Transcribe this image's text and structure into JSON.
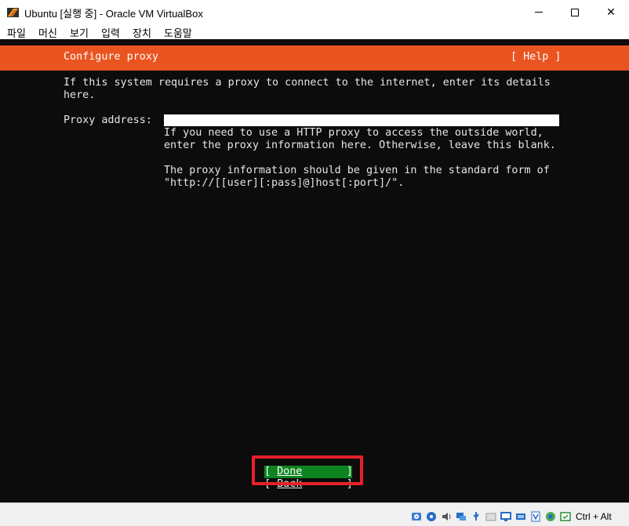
{
  "window": {
    "title": "Ubuntu [실행 중] - Oracle VM VirtualBox",
    "minimize_glyph": "",
    "maximize_glyph": "",
    "close_glyph": "✕"
  },
  "menu": {
    "items": [
      {
        "label": "파일"
      },
      {
        "label": "머신"
      },
      {
        "label": "보기"
      },
      {
        "label": "입력"
      },
      {
        "label": "장치"
      },
      {
        "label": "도움말"
      }
    ]
  },
  "installer": {
    "title": "Configure proxy",
    "help_label": "[ Help ]",
    "intro": "If this system requires a proxy to connect to the internet, enter its details\nhere.",
    "proxy_label": "Proxy address:",
    "proxy_value": "",
    "help_text_1": "If you need to use a HTTP proxy to access the outside world,\nenter the proxy information here. Otherwise, leave this blank.",
    "help_text_2": "The proxy information should be given in the standard form of\n\"http://[[user][:pass]@]host[:port]/\".",
    "done_open": "[ ",
    "done_label": "Done",
    "done_close": "       ]",
    "back_open": "[ ",
    "back_label": "Back",
    "back_close": "       ]"
  },
  "colors": {
    "ubuntu_orange": "#e95420",
    "done_green": "#0e8420",
    "annotation_red": "#e8202a",
    "console_bg": "#0c0c0c"
  },
  "statusbar": {
    "icons": [
      "hard-disk-icon",
      "optical-drive-icon",
      "audio-icon",
      "network-icon",
      "usb-icon",
      "shared-folder-icon",
      "display-icon",
      "video-capture-icon",
      "cpu-icon",
      "mouse-integration-icon",
      "keyboard-icon"
    ],
    "host_key": "Ctrl + Alt"
  }
}
